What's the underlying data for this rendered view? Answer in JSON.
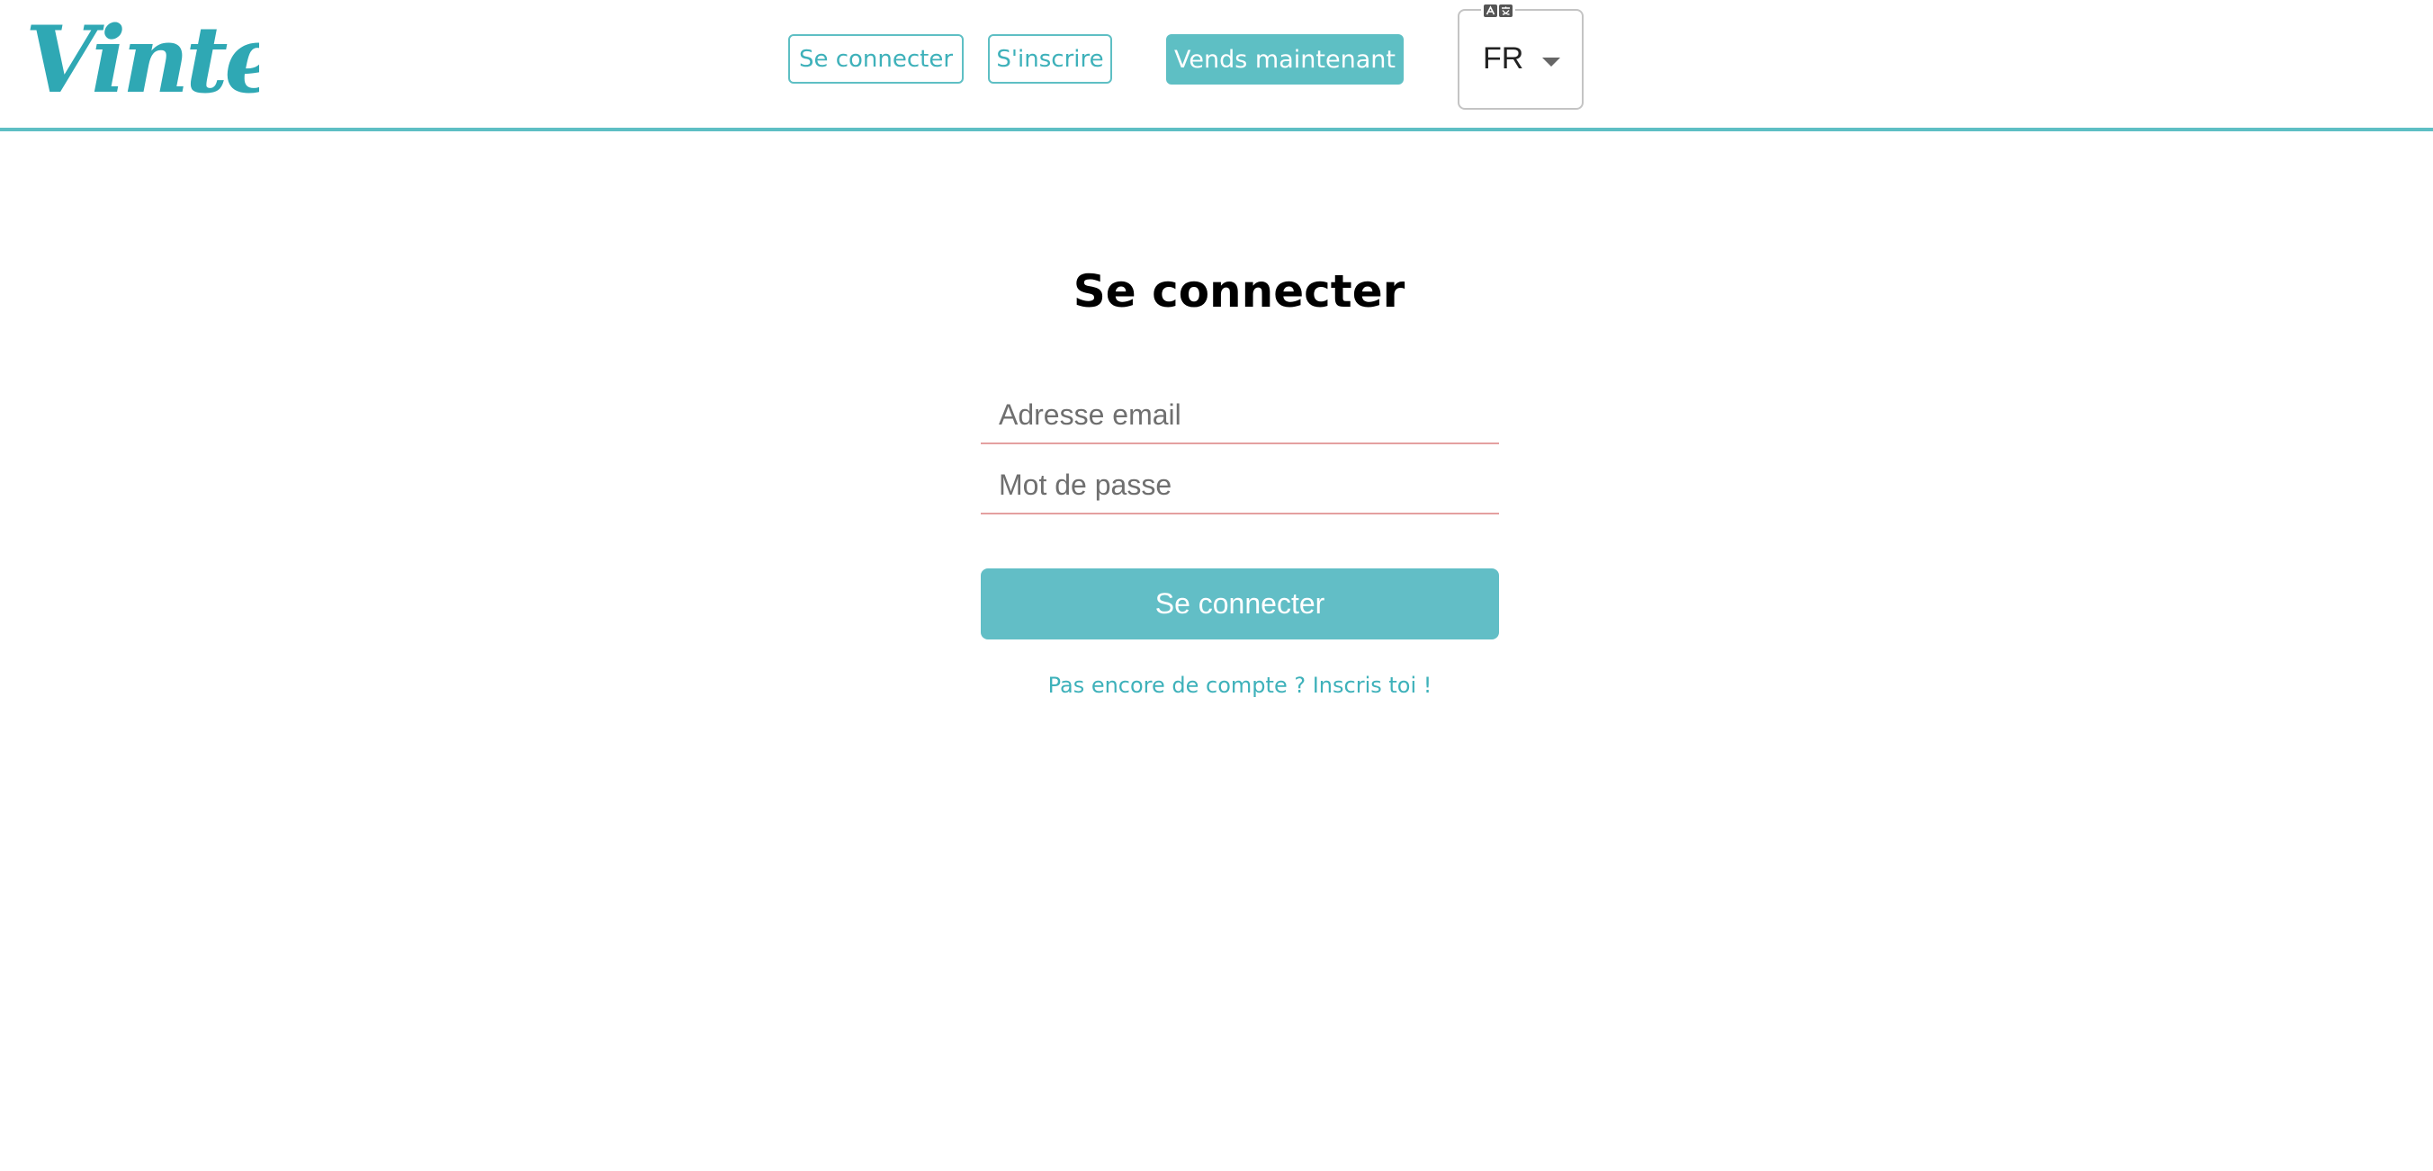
{
  "brand": {
    "logo_text": "Vinted",
    "accent_color": "#5ebfc4"
  },
  "header": {
    "login_label": "Se connecter",
    "signup_label": "S'inscrire",
    "sell_label": "Vends maintenant",
    "language": {
      "icon": "translate-icon",
      "selected": "FR"
    }
  },
  "login_form": {
    "title": "Se connecter",
    "email_placeholder": "Adresse email",
    "email_value": "",
    "password_placeholder": "Mot de passe",
    "password_value": "",
    "submit_label": "Se connecter",
    "signup_prompt": "Pas encore de compte ? Inscris toi !"
  }
}
